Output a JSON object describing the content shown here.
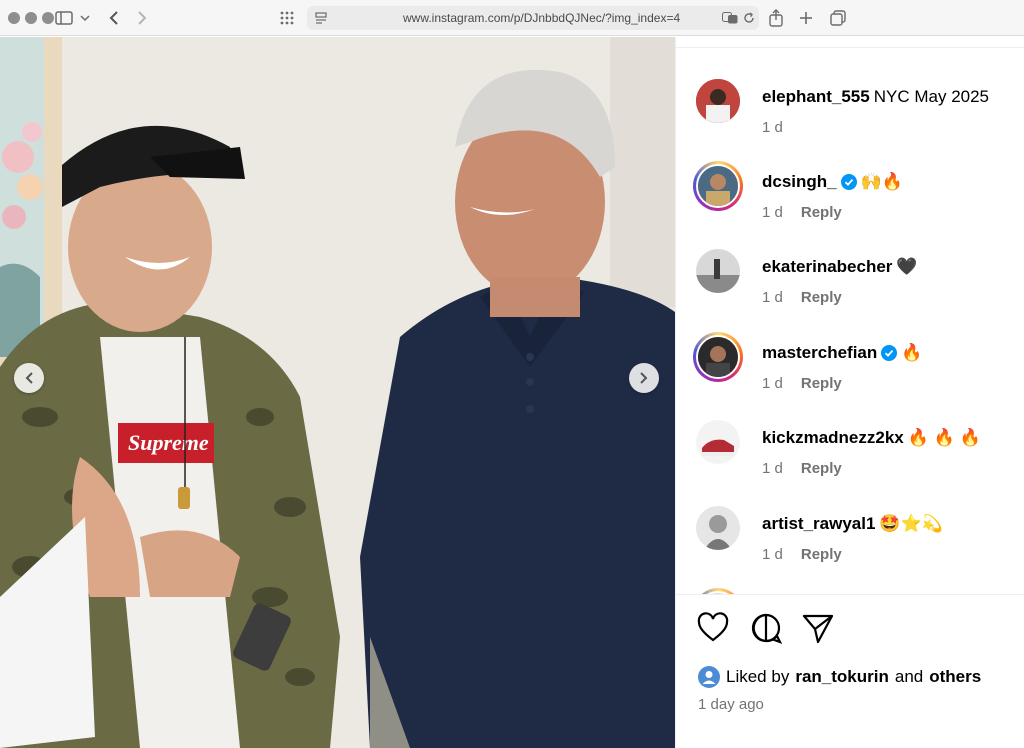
{
  "browser": {
    "url": "www.instagram.com/p/DJnbbdQJNec/?img_index=4"
  },
  "post": {
    "comments": [
      {
        "username": "elephant_555",
        "text": "NYC May 2025",
        "verified": false,
        "time": "1 d",
        "reply": "",
        "ring": false
      },
      {
        "username": "dcsingh_",
        "text": "🙌🔥",
        "verified": true,
        "time": "1 d",
        "reply": "Reply",
        "ring": true
      },
      {
        "username": "ekaterinabecher",
        "text": "🖤",
        "verified": false,
        "time": "1 d",
        "reply": "Reply",
        "ring": false
      },
      {
        "username": "masterchefian",
        "text": "🔥",
        "verified": true,
        "time": "1 d",
        "reply": "Reply",
        "ring": true
      },
      {
        "username": "kickzmadnezz2kx",
        "text": "🔥 🔥 🔥",
        "verified": false,
        "time": "1 d",
        "reply": "Reply",
        "ring": false
      },
      {
        "username": "artist_rawyal1",
        "text": "🤩⭐💫",
        "verified": false,
        "time": "1 d",
        "reply": "Reply",
        "ring": false
      }
    ],
    "likes": {
      "prefix": "Liked by",
      "user": "ran_tokurin",
      "joiner": "and",
      "others": "others"
    },
    "posted_time": "1 day ago"
  },
  "colors": {
    "verified": "#0095f6",
    "muted": "#737373"
  }
}
